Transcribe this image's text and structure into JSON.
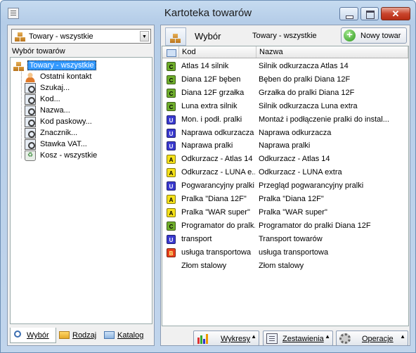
{
  "window": {
    "title": "Kartoteka towarów"
  },
  "left": {
    "combo_value": "Towary - wszystkie",
    "group_title": "Wybór towarów",
    "tree": [
      {
        "label": "Towary - wszystkie",
        "icon": "boxes-icon"
      },
      {
        "label": "Ostatni kontakt",
        "icon": "contact-icon"
      },
      {
        "label": "Szukaj...",
        "icon": "magnifier-icon"
      },
      {
        "label": "Kod...",
        "icon": "magnifier-icon"
      },
      {
        "label": "Nazwa...",
        "icon": "magnifier-icon"
      },
      {
        "label": "Kod paskowy...",
        "icon": "magnifier-icon"
      },
      {
        "label": "Znacznik...",
        "icon": "magnifier-icon"
      },
      {
        "label": "Stawka VAT...",
        "icon": "magnifier-icon"
      },
      {
        "label": "Kosz - wszystkie",
        "icon": "recycle-bin-icon"
      }
    ],
    "tabs": [
      {
        "label": "Wybór",
        "icon": "search-icon"
      },
      {
        "label": "Rodzaj",
        "icon": "folder-icon"
      },
      {
        "label": "Katalog",
        "icon": "catalog-folder-icon"
      }
    ]
  },
  "right": {
    "header_label": "Wybór",
    "filter_label": "Towary - wszystkie",
    "new_button": "Nowy towar",
    "columns": {
      "kod": "Kod",
      "nazwa": "Nazwa"
    },
    "rows": [
      {
        "type": "C",
        "kod": "Atlas 14 silnik",
        "nazwa": "Silnik odkurzacza Atlas 14"
      },
      {
        "type": "C",
        "kod": "Diana 12F bęben",
        "nazwa": "Bęben do pralki Diana 12F"
      },
      {
        "type": "C",
        "kod": "Diana 12F grzałka",
        "nazwa": "Grzałka do pralki Diana 12F"
      },
      {
        "type": "C",
        "kod": "Luna extra silnik",
        "nazwa": "Silnik odkurzacza Luna extra"
      },
      {
        "type": "U",
        "kod": "Mon. i podł. pralki",
        "nazwa": "Montaż i podłączenie pralki do instal..."
      },
      {
        "type": "U",
        "kod": "Naprawa odkurzacza",
        "nazwa": "Naprawa odkurzacza"
      },
      {
        "type": "U",
        "kod": "Naprawa pralki",
        "nazwa": "Naprawa pralki"
      },
      {
        "type": "A",
        "kod": "Odkurzacz - Atlas 14",
        "nazwa": "Odkurzacz - Atlas 14"
      },
      {
        "type": "A",
        "kod": "Odkurzacz - LUNA e...",
        "nazwa": "Odkurzacz - LUNA extra"
      },
      {
        "type": "U",
        "kod": "Pogwarancyjny pralki",
        "nazwa": "Przegląd pogwarancyjny pralki"
      },
      {
        "type": "A",
        "kod": "Pralka \"Diana 12F\"",
        "nazwa": "Pralka \"Diana 12F\""
      },
      {
        "type": "A",
        "kod": "Pralka \"WAR super\"",
        "nazwa": "Pralka \"WAR super\""
      },
      {
        "type": "C",
        "kod": "Programator do pralk...",
        "nazwa": "Programator do pralki Diana 12F"
      },
      {
        "type": "U",
        "kod": "transport",
        "nazwa": "Transport towarów"
      },
      {
        "type": "B",
        "kod": "usługa transportowa",
        "nazwa": "usługa transportowa"
      },
      {
        "type": "",
        "kod": "Złom stalowy",
        "nazwa": "Złom stalowy"
      }
    ],
    "badge_colors": {
      "C": {
        "bg": "#6fae2c",
        "fg": "#000000"
      },
      "U": {
        "bg": "#3a3acf",
        "fg": "#ffffff"
      },
      "A": {
        "bg": "#f5e11a",
        "fg": "#000000"
      },
      "B": {
        "bg": "#e8401c",
        "fg": "#ffff80"
      }
    },
    "bottom_buttons": [
      {
        "label": "Wykresy",
        "icon": "bar-chart-icon"
      },
      {
        "label": "Zestawienia",
        "icon": "report-icon"
      },
      {
        "label": "Operacje",
        "icon": "gear-icon"
      }
    ]
  }
}
